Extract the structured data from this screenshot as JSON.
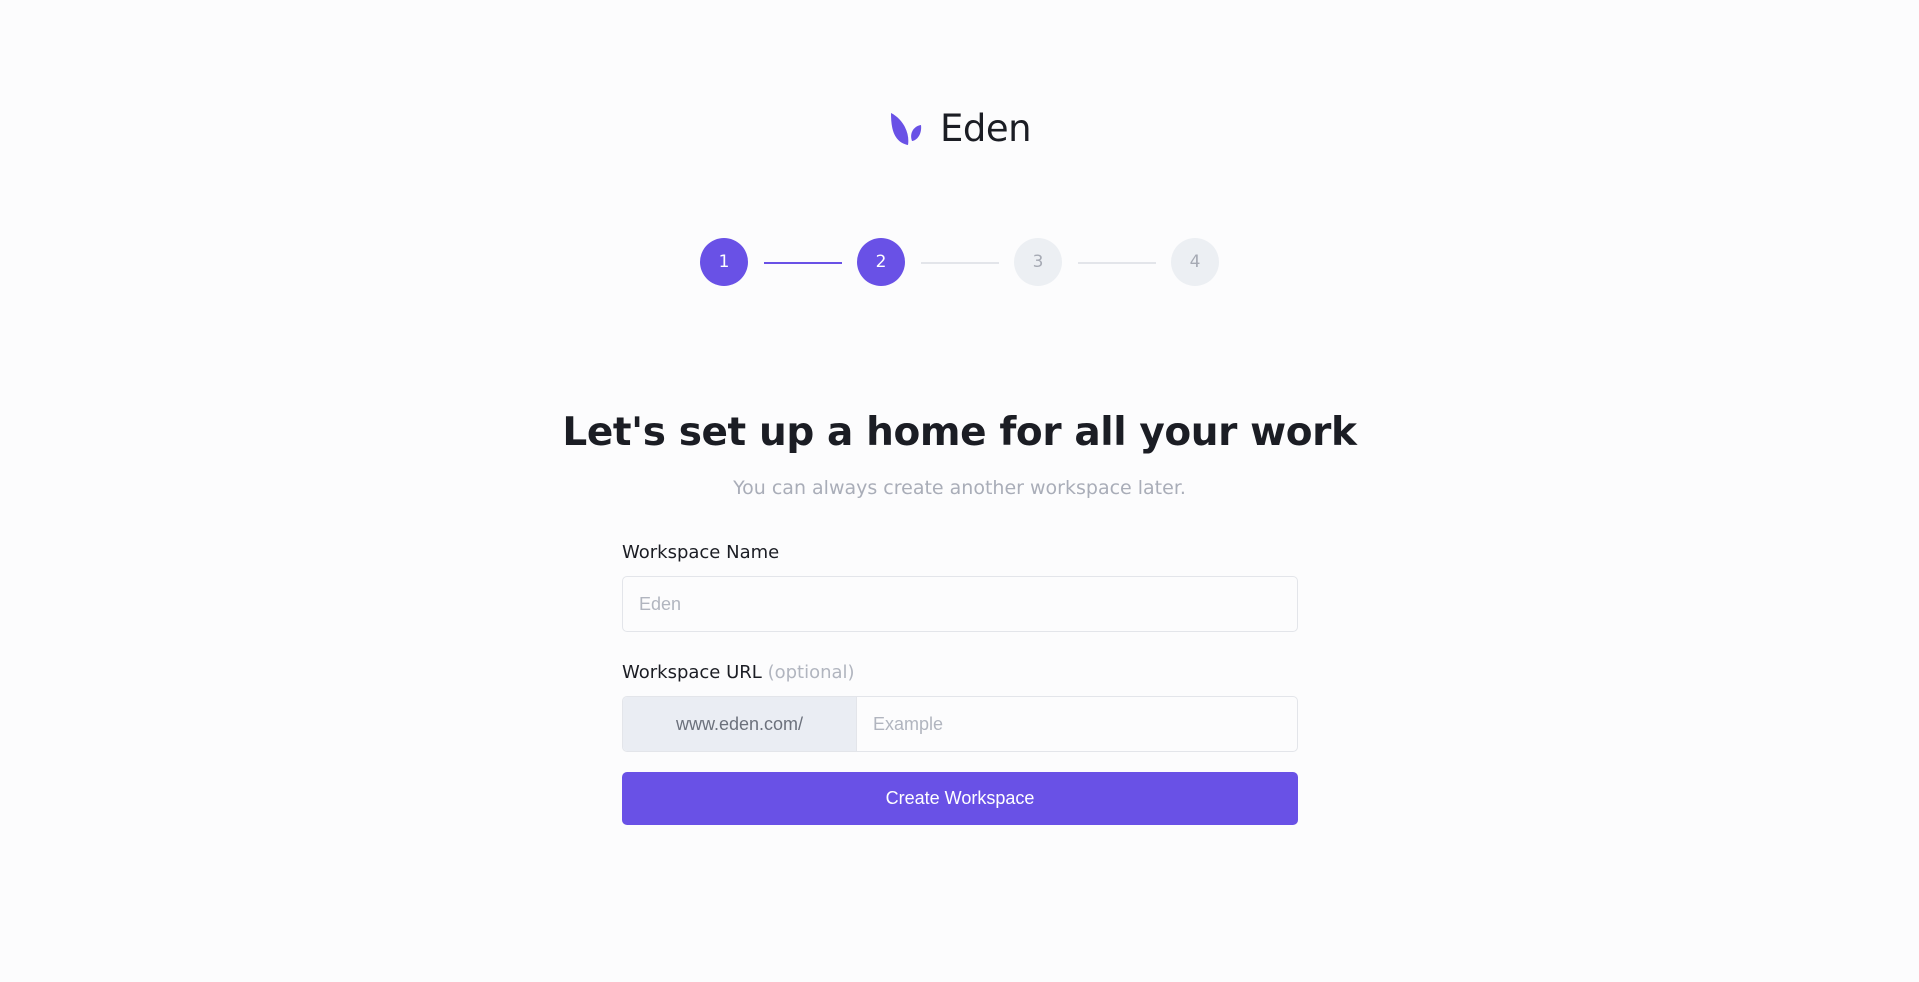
{
  "brand": {
    "name": "Eden",
    "logo_icon": "leaf-logo-icon",
    "accent_color": "#6951e6"
  },
  "stepper": {
    "current_step": 2,
    "steps": [
      {
        "label": "1",
        "state": "complete"
      },
      {
        "label": "2",
        "state": "active"
      },
      {
        "label": "3",
        "state": "upcoming"
      },
      {
        "label": "4",
        "state": "upcoming"
      }
    ]
  },
  "main": {
    "heading": "Let's set up a home for all your work",
    "subheading": "You can always create another workspace later."
  },
  "form": {
    "workspace_name": {
      "label": "Workspace Name",
      "value": "",
      "placeholder": "Eden"
    },
    "workspace_url": {
      "label": "Workspace URL",
      "optional_label": "(optional)",
      "prefix": "www.eden.com/",
      "value": "",
      "placeholder": "Example"
    },
    "submit_label": "Create Workspace"
  }
}
